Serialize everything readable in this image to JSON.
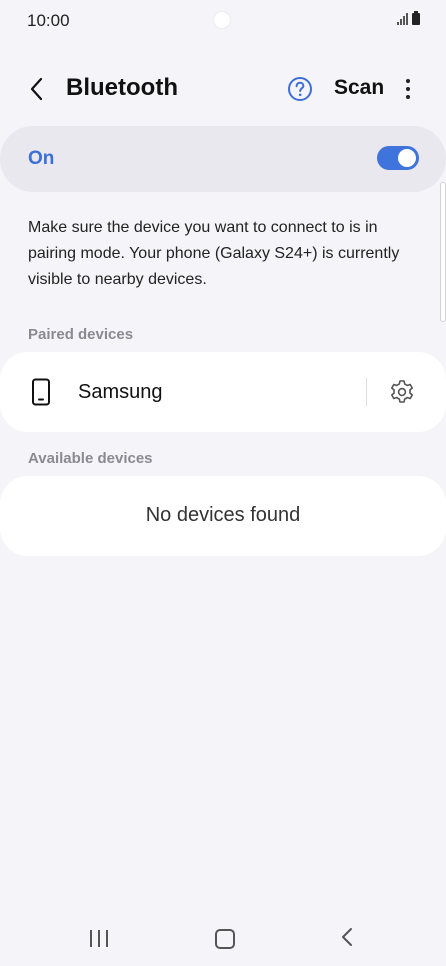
{
  "status_bar": {
    "time": "10:00"
  },
  "app_bar": {
    "title": "Bluetooth",
    "scan_label": "Scan"
  },
  "master_switch": {
    "label": "On",
    "enabled": true,
    "accent": "#3e74dc"
  },
  "info_text": "Make sure the device you want to connect to is in pairing mode. Your phone (Galaxy S24+) is currently visible to nearby devices.",
  "paired": {
    "header": "Paired devices",
    "devices": [
      {
        "name": "Samsung",
        "icon": "phone-icon"
      }
    ]
  },
  "available": {
    "header": "Available devices",
    "empty_text": "No devices found"
  }
}
